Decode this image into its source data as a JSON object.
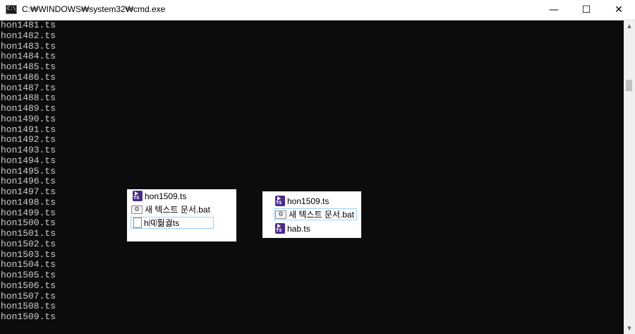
{
  "window": {
    "title": "C:₩WINDOWS₩system32₩cmd.exe",
    "icon_text": "C:\\",
    "minimize": "—",
    "maximize": "☐",
    "close": "✕"
  },
  "console": {
    "lines": [
      "hon1481.ts",
      "hon1482.ts",
      "hon1483.ts",
      "hon1484.ts",
      "hon1485.ts",
      "hon1486.ts",
      "hon1487.ts",
      "hon1488.ts",
      "hon1489.ts",
      "hon1490.ts",
      "hon1491.ts",
      "hon1492.ts",
      "hon1493.ts",
      "hon1494.ts",
      "hon1495.ts",
      "hon1496.ts",
      "hon1497.ts",
      "hon1498.ts",
      "hon1499.ts",
      "hon1500.ts",
      "hon1501.ts",
      "hon1502.ts",
      "hon1503.ts",
      "hon1504.ts",
      "hon1505.ts",
      "hon1506.ts",
      "hon1507.ts",
      "hon1508.ts",
      "hon1509.ts"
    ]
  },
  "scrollbar": {
    "up": "▲",
    "down": "▼"
  },
  "panel_left": {
    "items": [
      {
        "label": "hon1509.ts",
        "icon": "ts-video-icon",
        "selected": false
      },
      {
        "label": "새 텍스트 문서.bat",
        "icon": "bat-file-icon",
        "selected": false
      },
      {
        "label": "h⒬뤎궗ts",
        "icon": "document-icon",
        "selected": true
      }
    ]
  },
  "panel_right": {
    "items": [
      {
        "label": "hon1509.ts",
        "icon": "ts-video-icon",
        "selected": false
      },
      {
        "label": "새 텍스트 문서.bat",
        "icon": "bat-file-icon",
        "selected": true
      },
      {
        "label": "hab.ts",
        "icon": "ts-video-icon",
        "selected": false
      }
    ]
  }
}
